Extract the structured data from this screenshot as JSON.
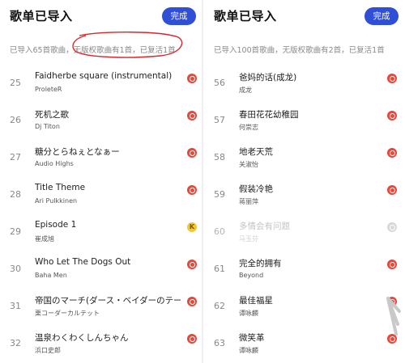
{
  "left": {
    "title": "歌单已导入",
    "done_label": "完成",
    "summary": "已导入65首歌曲，无版权歌曲有1首，已复活1首",
    "rows": [
      {
        "num": "25",
        "song": "Faidherbe square (instrumental)",
        "artist": "ProleteR",
        "source": "netease"
      },
      {
        "num": "26",
        "song": "死机之歌",
        "artist": "Dj Titon",
        "source": "netease"
      },
      {
        "num": "27",
        "song": "糖分とらねぇとなぁー",
        "artist": "Audio Highs",
        "source": "netease"
      },
      {
        "num": "28",
        "song": "Title Theme",
        "artist": "Ari Pulkkinen",
        "source": "netease"
      },
      {
        "num": "29",
        "song": "Episode 1",
        "artist": "崔成旭",
        "source": "k"
      },
      {
        "num": "30",
        "song": "Who Let The Dogs Out",
        "artist": "Baha Men",
        "source": "netease"
      },
      {
        "num": "31",
        "song": "帝国のマーチ(ダース・ベイダーのテー",
        "artist": "栗コーダーカルテット",
        "source": "netease"
      },
      {
        "num": "32",
        "song": "温泉わくわくしんちゃん",
        "artist": "浜口史郎",
        "source": "netease"
      }
    ]
  },
  "right": {
    "title": "歌单已导入",
    "done_label": "完成",
    "summary": "已导入100首歌曲，无版权歌曲有2首，已复活1首",
    "rows": [
      {
        "num": "56",
        "song": "爸妈的话(成龙)",
        "artist": "成龙",
        "source": "netease"
      },
      {
        "num": "57",
        "song": "春田花花幼稚园",
        "artist": "何崇志",
        "source": "netease"
      },
      {
        "num": "58",
        "song": "地老天荒",
        "artist": "关淑怡",
        "source": "netease"
      },
      {
        "num": "59",
        "song": "假装冷艳",
        "artist": "蒋丽萍",
        "source": "netease"
      },
      {
        "num": "60",
        "song": "多情会有问题",
        "artist": "马玉芬",
        "source": "grey",
        "faded": true
      },
      {
        "num": "61",
        "song": "完全的拥有",
        "artist": "Beyond",
        "source": "netease"
      },
      {
        "num": "62",
        "song": "最佳福星",
        "artist": "谭咏麟",
        "source": "netease"
      },
      {
        "num": "63",
        "song": "微笑革",
        "artist": "谭咏麟",
        "source": "netease"
      }
    ]
  },
  "colors": {
    "accent_blue": "#2f4fd6",
    "netease_red": "#e8483a",
    "k_yellow": "#f4c53a",
    "annotation_red": "#d9252b"
  },
  "icon_names": {
    "netease": "netease-music-icon",
    "k": "k-music-icon",
    "grey": "unavailable-music-icon"
  }
}
